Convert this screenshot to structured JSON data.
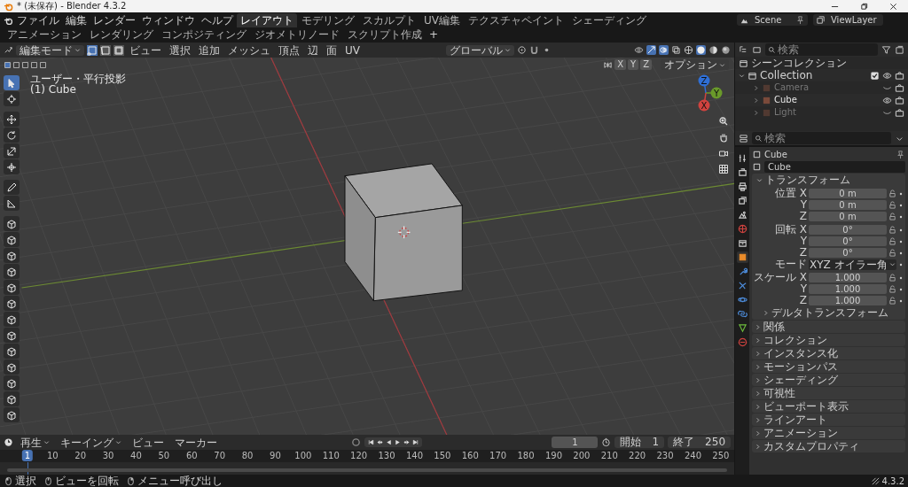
{
  "window": {
    "title": "* (未保存) - Blender 4.3.2"
  },
  "menu": [
    "ファイル",
    "編集",
    "レンダー",
    "ウィンドウ",
    "ヘルプ"
  ],
  "workspaces": [
    {
      "label": "レイアウト",
      "selected": true
    },
    {
      "label": "モデリング",
      "selected": false
    },
    {
      "label": "スカルプト",
      "selected": false
    },
    {
      "label": "UV編集",
      "selected": false
    },
    {
      "label": "テクスチャペイント",
      "selected": false
    },
    {
      "label": "シェーディング",
      "selected": false
    },
    {
      "label": "アニメーション",
      "selected": false
    },
    {
      "label": "レンダリング",
      "selected": false
    },
    {
      "label": "コンポジティング",
      "selected": false
    },
    {
      "label": "ジオメトリノード",
      "selected": false
    },
    {
      "label": "スクリプト作成",
      "selected": false
    }
  ],
  "add_workspace": "+",
  "scene": "Scene",
  "view_layer": "ViewLayer",
  "viewport": {
    "mode": "編集モード",
    "select_modes": [
      {
        "kind": "vertex",
        "selected": true
      },
      {
        "kind": "edge",
        "selected": false
      },
      {
        "kind": "face",
        "selected": false
      }
    ],
    "menus": [
      "ビュー",
      "選択",
      "追加",
      "メッシュ",
      "頂点",
      "辺",
      "面",
      "UV"
    ],
    "orientation": "グローバル",
    "mirror_axes": [
      "X",
      "Y",
      "Z"
    ],
    "options": "オプション",
    "view_name": "ユーザー・平行投影",
    "object_label": "(1) Cube",
    "tools": [
      {
        "kind": "select",
        "selected": true
      },
      {
        "kind": "cursor",
        "selected": false
      },
      {
        "kind": "move",
        "selected": false
      },
      {
        "kind": "rotate",
        "selected": false
      },
      {
        "kind": "scale",
        "selected": false
      },
      {
        "kind": "transform",
        "selected": false
      },
      {
        "kind": "annotate",
        "selected": false
      },
      {
        "kind": "measure",
        "selected": false
      },
      {
        "kind": "add_cube",
        "selected": false
      },
      {
        "kind": "extrude",
        "selected": false
      },
      {
        "kind": "inset",
        "selected": false
      },
      {
        "kind": "bevel",
        "selected": false
      },
      {
        "kind": "loopcut",
        "selected": false
      },
      {
        "kind": "knife",
        "selected": false
      },
      {
        "kind": "polybuild",
        "selected": false
      },
      {
        "kind": "spin",
        "selected": false
      },
      {
        "kind": "smooth",
        "selected": false
      },
      {
        "kind": "edge_slide",
        "selected": false
      },
      {
        "kind": "shrink",
        "selected": false
      },
      {
        "kind": "shear",
        "selected": false
      },
      {
        "kind": "rip",
        "selected": false
      }
    ],
    "gizmo_axes": [
      {
        "label": "Z",
        "color": "#2f6fd6"
      },
      {
        "label": "Y",
        "color": "#6a9a2a"
      },
      {
        "label": "X",
        "color": "#d0433f"
      }
    ]
  },
  "outliner": {
    "search_placeholder": "検索",
    "scene_collection": "シーンコレクション",
    "collection": {
      "name": "Collection",
      "checked": true,
      "children": [
        {
          "name": "Camera",
          "visible": false
        },
        {
          "name": "Cube",
          "visible": true
        },
        {
          "name": "Light",
          "visible": false
        }
      ]
    }
  },
  "properties": {
    "search_placeholder": "検索",
    "tabs": [
      {
        "kind": "tool",
        "selected": false
      },
      {
        "kind": "render",
        "selected": false
      },
      {
        "kind": "output",
        "selected": false
      },
      {
        "kind": "view_layer",
        "selected": false
      },
      {
        "kind": "scene",
        "selected": false
      },
      {
        "kind": "world",
        "selected": false
      },
      {
        "kind": "collection",
        "selected": false
      },
      {
        "kind": "object",
        "selected": true
      },
      {
        "kind": "modifier",
        "selected": false
      },
      {
        "kind": "particles",
        "selected": false
      },
      {
        "kind": "physics",
        "selected": false
      },
      {
        "kind": "constraints",
        "selected": false
      },
      {
        "kind": "data",
        "selected": false
      },
      {
        "kind": "material",
        "selected": false
      }
    ],
    "object_name": "Cube",
    "data_name": "Cube",
    "transform": {
      "title": "トランスフォーム",
      "expanded": true,
      "groups": [
        {
          "rows": [
            {
              "kind": "number",
              "label": "位置 X",
              "value": "0 m"
            },
            {
              "kind": "number",
              "label": "Y",
              "value": "0 m"
            },
            {
              "kind": "number",
              "label": "Z",
              "value": "0 m"
            }
          ]
        },
        {
          "rows": [
            {
              "kind": "number",
              "label": "回転 X",
              "value": "0°"
            },
            {
              "kind": "number",
              "label": "Y",
              "value": "0°"
            },
            {
              "kind": "number",
              "label": "Z",
              "value": "0°"
            },
            {
              "kind": "dropdown",
              "label": "モード",
              "value": "XYZ オイラー角"
            }
          ]
        },
        {
          "rows": [
            {
              "kind": "number",
              "label": "スケール X",
              "value": "1.000"
            },
            {
              "kind": "number",
              "label": "Y",
              "value": "1.000"
            },
            {
              "kind": "number",
              "label": "Z",
              "value": "1.000"
            }
          ]
        }
      ],
      "sub": {
        "title": "デルタトランスフォーム",
        "expanded": false
      }
    },
    "sections": [
      {
        "title": "関係",
        "expanded": false
      },
      {
        "title": "コレクション",
        "expanded": false
      },
      {
        "title": "インスタンス化",
        "expanded": false
      },
      {
        "title": "モーションパス",
        "expanded": false
      },
      {
        "title": "シェーディング",
        "expanded": false
      },
      {
        "title": "可視性",
        "expanded": false
      },
      {
        "title": "ビューポート表示",
        "expanded": false
      },
      {
        "title": "ラインアート",
        "expanded": false
      },
      {
        "title": "アニメーション",
        "expanded": false
      },
      {
        "title": "カスタムプロパティ",
        "expanded": false
      }
    ]
  },
  "timeline": {
    "menus": [
      {
        "label": "再生",
        "dropdown": true
      },
      {
        "label": "キーイング",
        "dropdown": true
      },
      {
        "label": "ビュー",
        "dropdown": false
      },
      {
        "label": "マーカー",
        "dropdown": false
      }
    ],
    "current_frame": "1",
    "start_label": "開始",
    "start": "1",
    "end_label": "終了",
    "end": "250",
    "playhead": "1",
    "ruler": [
      "10",
      "20",
      "30",
      "40",
      "50",
      "60",
      "70",
      "80",
      "90",
      "100",
      "110",
      "120",
      "130",
      "140",
      "150",
      "160",
      "170",
      "180",
      "190",
      "200",
      "210",
      "220",
      "230",
      "240",
      "250"
    ]
  },
  "status_bar": {
    "hints": [
      {
        "kind": "left",
        "label": "選択"
      },
      {
        "kind": "middle",
        "label": "ビューを回転"
      },
      {
        "kind": "right",
        "label": "メニュー呼び出し"
      }
    ],
    "version": "4.3.2"
  }
}
